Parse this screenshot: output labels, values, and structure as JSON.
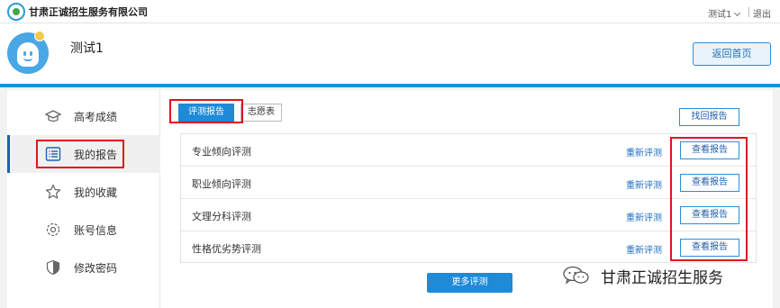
{
  "header": {
    "company": "甘肃正诚招生服务有限公司",
    "user_menu": "测试1",
    "logout": "退出"
  },
  "profile": {
    "username": "测试1",
    "back_home": "返回首页"
  },
  "sidebar": {
    "items": [
      {
        "label": "高考成绩",
        "icon": "graduation-cap-icon"
      },
      {
        "label": "我的报告",
        "icon": "list-icon"
      },
      {
        "label": "我的收藏",
        "icon": "star-icon"
      },
      {
        "label": "账号信息",
        "icon": "gear-icon"
      },
      {
        "label": "修改密码",
        "icon": "shield-icon"
      }
    ],
    "active_index": 1
  },
  "tabs": [
    {
      "label": "评测报告",
      "active": true
    },
    {
      "label": "志愿表",
      "active": false
    }
  ],
  "find_report": "找回报告",
  "reports": [
    {
      "title": "专业倾向评测",
      "retest": "重新评测",
      "view": "查看报告"
    },
    {
      "title": "职业倾向评测",
      "retest": "重新评测",
      "view": "查看报告"
    },
    {
      "title": "文理分科评测",
      "retest": "重新评测",
      "view": "查看报告"
    },
    {
      "title": "性格优劣势评测",
      "retest": "重新评测",
      "view": "查看报告"
    }
  ],
  "more_button": "更多评测",
  "watermark": "甘肃正诚招生服务",
  "colors": {
    "accent": "#1e8ad8",
    "highlight": "#e0141e",
    "link": "#1e6fc0"
  }
}
